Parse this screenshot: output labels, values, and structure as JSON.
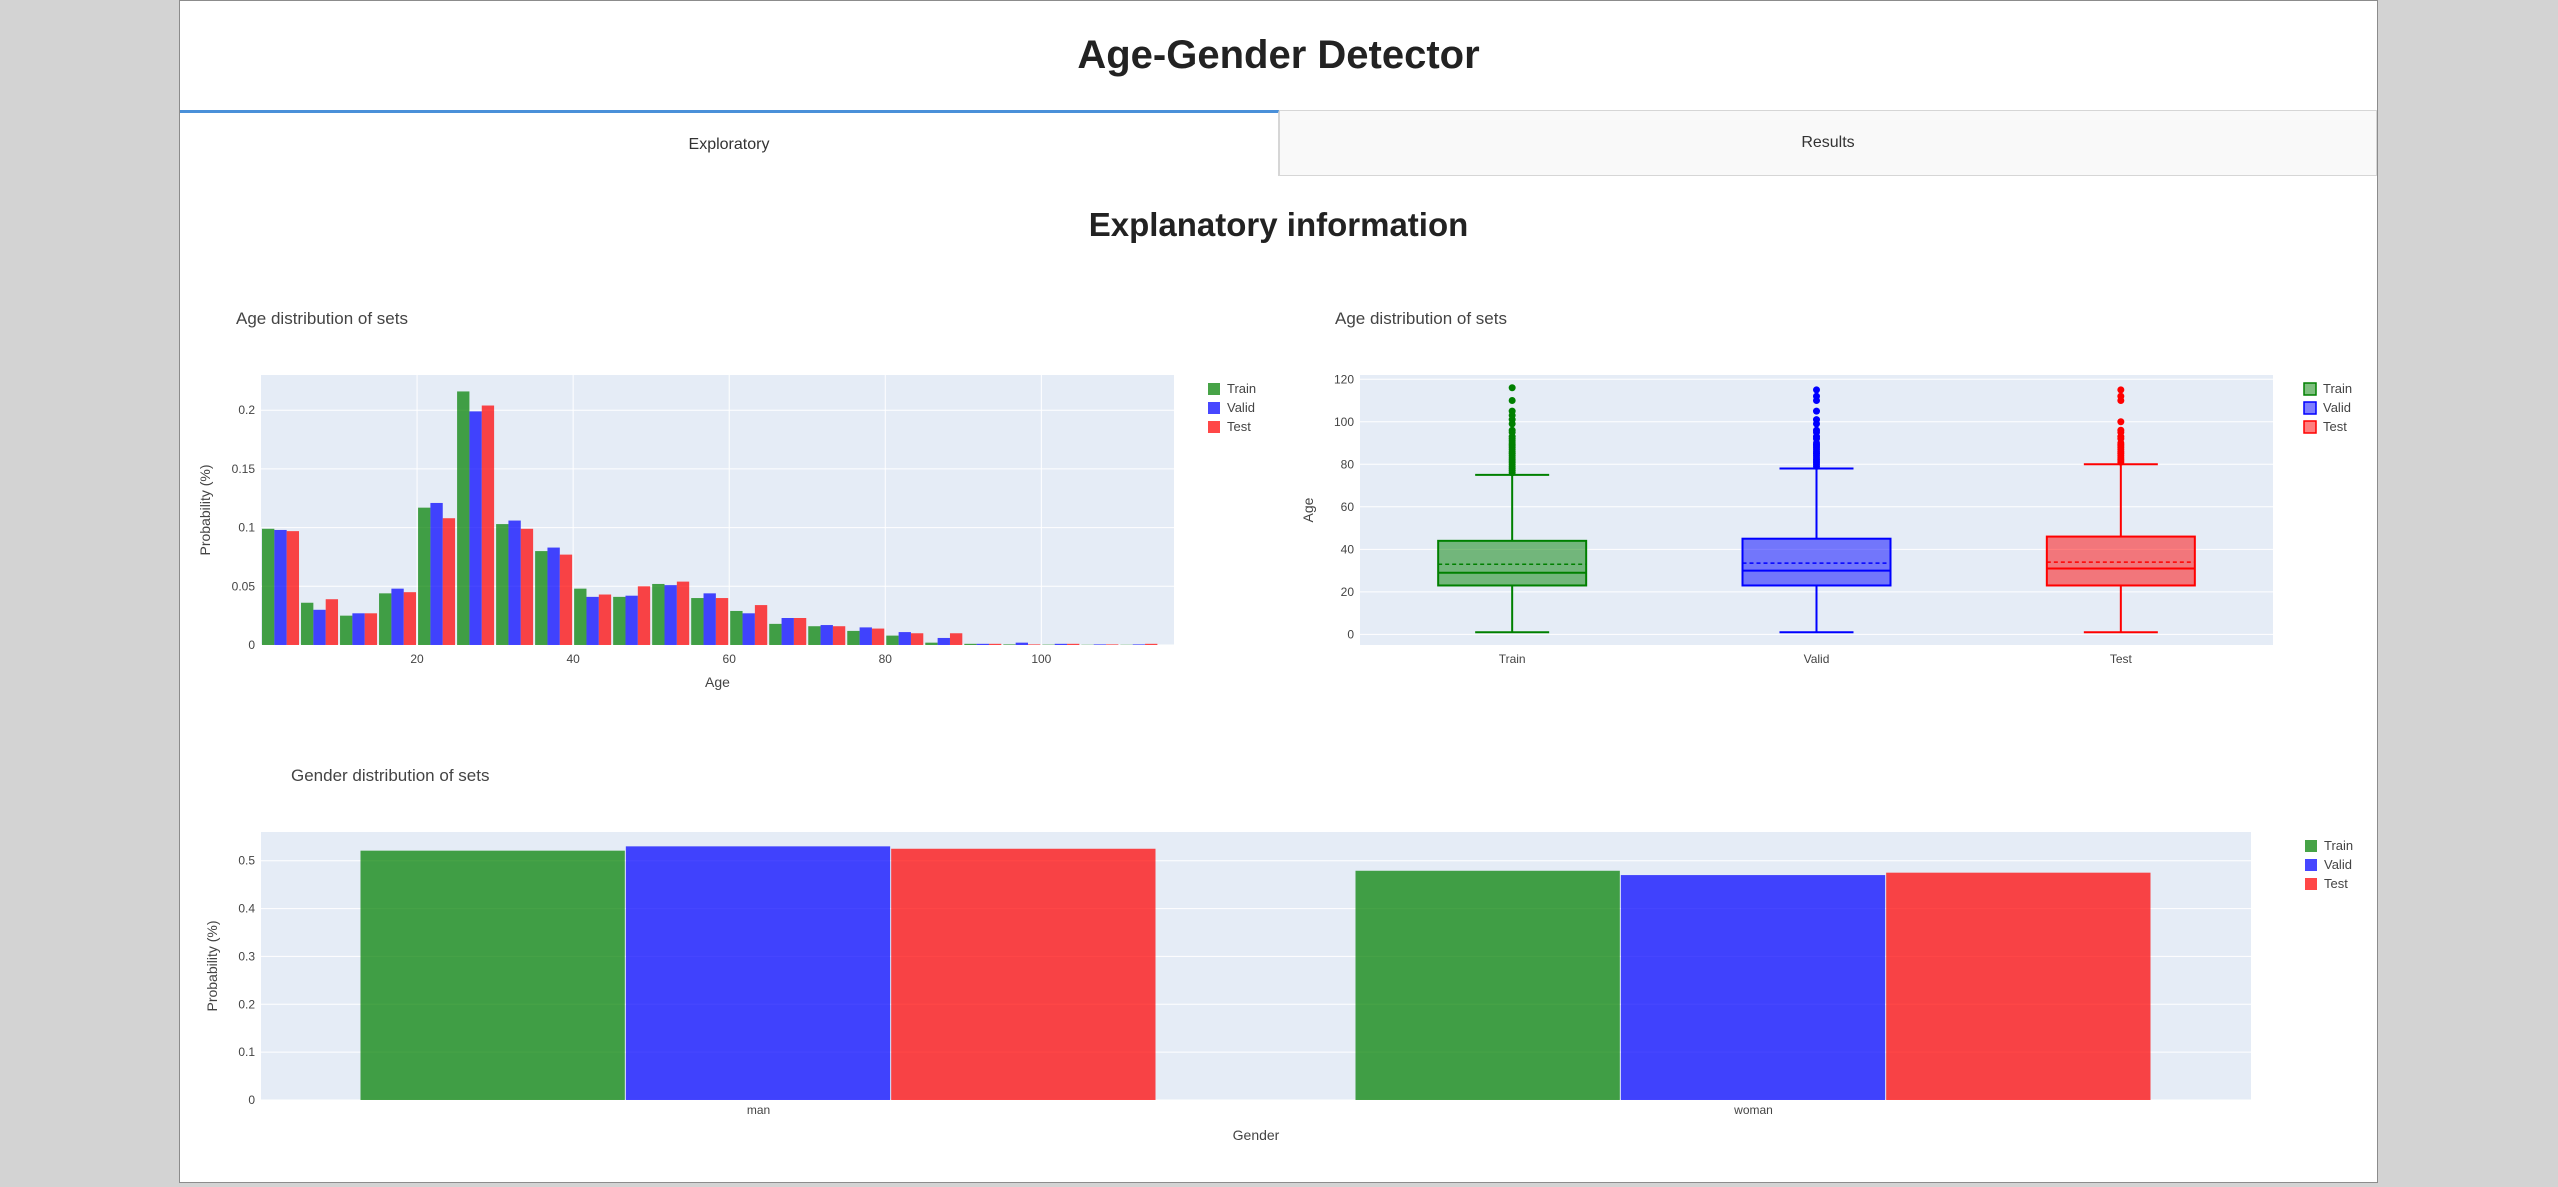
{
  "app": {
    "title": "Age-Gender Detector"
  },
  "tabs": [
    {
      "label": "Exploratory",
      "active": true
    },
    {
      "label": "Results",
      "active": false
    }
  ],
  "section": {
    "title": "Explanatory information"
  },
  "colors": {
    "Train": "#008000",
    "Valid": "#0000ff",
    "Test": "#ff0000",
    "plot_bg": "#e5ecf6"
  },
  "chart_data": [
    {
      "id": "age-hist",
      "type": "bar",
      "title": "Age distribution of sets",
      "xlabel": "Age",
      "ylabel": "Probability (%)",
      "xlim": [
        0,
        117
      ],
      "ylim": [
        0,
        0.23
      ],
      "xticks": [
        20,
        40,
        60,
        80,
        100
      ],
      "yticks": [
        0,
        0.05,
        0.1,
        0.15,
        0.2
      ],
      "ytick_labels": [
        "0",
        "0.05",
        "0.1",
        "0.15",
        "0.2"
      ],
      "bin_starts": [
        0,
        5,
        10,
        15,
        20,
        25,
        30,
        35,
        40,
        45,
        50,
        55,
        60,
        65,
        70,
        75,
        80,
        85,
        90,
        95,
        100,
        105,
        110
      ],
      "bin_width": 5,
      "legend_position": "right",
      "series": [
        {
          "name": "Train",
          "values": [
            0.099,
            0.036,
            0.025,
            0.044,
            0.117,
            0.216,
            0.103,
            0.08,
            0.048,
            0.041,
            0.052,
            0.04,
            0.029,
            0.018,
            0.016,
            0.012,
            0.008,
            0.002,
            0.001,
            0.0005,
            0.0003,
            0.0002,
            0.0002
          ]
        },
        {
          "name": "Valid",
          "values": [
            0.098,
            0.03,
            0.027,
            0.048,
            0.121,
            0.199,
            0.106,
            0.083,
            0.041,
            0.042,
            0.051,
            0.044,
            0.027,
            0.023,
            0.017,
            0.015,
            0.011,
            0.006,
            0.001,
            0.002,
            0.001,
            0.0005,
            0.0005
          ]
        },
        {
          "name": "Test",
          "values": [
            0.097,
            0.039,
            0.027,
            0.045,
            0.108,
            0.204,
            0.099,
            0.077,
            0.043,
            0.05,
            0.054,
            0.04,
            0.034,
            0.023,
            0.016,
            0.014,
            0.01,
            0.01,
            0.001,
            0.0005,
            0.001,
            0.0005,
            0.001
          ]
        }
      ]
    },
    {
      "id": "age-box",
      "type": "box",
      "title": "Age distribution of sets",
      "xlabel": "",
      "ylabel": "Age",
      "ylim": [
        -5,
        122
      ],
      "yticks": [
        0,
        20,
        40,
        60,
        80,
        100,
        120
      ],
      "categories": [
        "Train",
        "Valid",
        "Test"
      ],
      "legend_position": "right",
      "series": [
        {
          "name": "Train",
          "min": 1,
          "q1": 23,
          "median": 29,
          "mean": 33,
          "q3": 44,
          "max": 75,
          "outliers": [
            76,
            77,
            78,
            79,
            80,
            81,
            82,
            83,
            84,
            85,
            86,
            87,
            88,
            89,
            90,
            91,
            92,
            93,
            95,
            96,
            99,
            101,
            103,
            105,
            110,
            116
          ]
        },
        {
          "name": "Valid",
          "min": 1,
          "q1": 23,
          "median": 30,
          "mean": 33.5,
          "q3": 45,
          "max": 78,
          "outliers": [
            79,
            80,
            81,
            82,
            83,
            84,
            85,
            86,
            87,
            88,
            89,
            90,
            92,
            93,
            95,
            96,
            99,
            101,
            105,
            110,
            112,
            115
          ]
        },
        {
          "name": "Test",
          "min": 1,
          "q1": 23,
          "median": 31,
          "mean": 34,
          "q3": 46,
          "max": 80,
          "outliers": [
            81,
            82,
            83,
            84,
            85,
            86,
            87,
            88,
            89,
            90,
            92,
            93,
            95,
            96,
            100,
            110,
            112,
            115
          ]
        }
      ]
    },
    {
      "id": "gender-bar",
      "type": "bar",
      "title": "Gender distribution of sets",
      "xlabel": "Gender",
      "ylabel": "Probability (%)",
      "ylim": [
        0,
        0.56
      ],
      "yticks": [
        0,
        0.1,
        0.2,
        0.3,
        0.4,
        0.5
      ],
      "ytick_labels": [
        "0",
        "0.1",
        "0.2",
        "0.3",
        "0.4",
        "0.5"
      ],
      "categories": [
        "man",
        "woman"
      ],
      "legend_position": "right",
      "series": [
        {
          "name": "Train",
          "values": [
            0.521,
            0.479
          ]
        },
        {
          "name": "Valid",
          "values": [
            0.53,
            0.47
          ]
        },
        {
          "name": "Test",
          "values": [
            0.525,
            0.475
          ]
        }
      ]
    }
  ]
}
